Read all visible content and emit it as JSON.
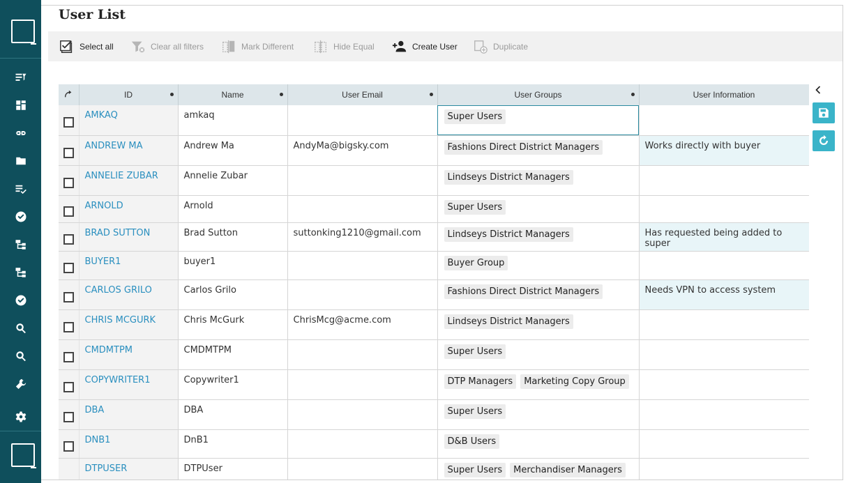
{
  "page": {
    "title": "User List"
  },
  "toolbar": {
    "select_all": "Select all",
    "clear_filters": "Clear all filters",
    "mark_different": "Mark Different",
    "hide_equal": "Hide Equal",
    "create_user": "Create User",
    "duplicate": "Duplicate"
  },
  "columns": {
    "id": "ID",
    "name": "Name",
    "email": "User Email",
    "groups": "User Groups",
    "info": "User Information"
  },
  "rows": [
    {
      "id": "AMKAQ",
      "name": "amkaq",
      "email": "",
      "groups": [
        "Super Users"
      ],
      "info": ""
    },
    {
      "id": "ANDREW MA",
      "name": "Andrew Ma",
      "email": "AndyMa@bigsky.com",
      "groups": [
        "Fashions Direct District Managers"
      ],
      "info": "Works directly with buyer"
    },
    {
      "id": "ANNELIE ZUBAR",
      "name": "Annelie Zubar",
      "email": "",
      "groups": [
        "Lindseys District Managers"
      ],
      "info": ""
    },
    {
      "id": "ARNOLD",
      "name": "Arnold",
      "email": "",
      "groups": [
        "Super Users"
      ],
      "info": ""
    },
    {
      "id": "BRAD SUTTON",
      "name": "Brad Sutton",
      "email": "suttonking1210@gmail.com",
      "groups": [
        "Lindseys District Managers"
      ],
      "info": "Has requested being added to super"
    },
    {
      "id": "BUYER1",
      "name": "buyer1",
      "email": "",
      "groups": [
        "Buyer Group"
      ],
      "info": ""
    },
    {
      "id": "CARLOS GRILO",
      "name": "Carlos Grilo",
      "email": "",
      "groups": [
        "Fashions Direct District Managers"
      ],
      "info": "Needs VPN to access system"
    },
    {
      "id": "CHRIS MCGURK",
      "name": "Chris McGurk",
      "email": "ChrisMcg@acme.com",
      "groups": [
        "Lindseys District Managers"
      ],
      "info": ""
    },
    {
      "id": "CMDMTPM",
      "name": "CMDMTPM",
      "email": "",
      "groups": [
        "Super Users"
      ],
      "info": ""
    },
    {
      "id": "COPYWRITER1",
      "name": "Copywriter1",
      "email": "",
      "groups": [
        "DTP Managers",
        "Marketing Copy Group"
      ],
      "info": ""
    },
    {
      "id": "DBA",
      "name": "DBA",
      "email": "",
      "groups": [
        "Super Users"
      ],
      "info": ""
    },
    {
      "id": "DNB1",
      "name": "DnB1",
      "email": "",
      "groups": [
        "D&B Users"
      ],
      "info": ""
    },
    {
      "id": "DTPUSER",
      "name": "DTPUser",
      "email": "",
      "groups": [
        "Super Users",
        "Merchandiser Managers"
      ],
      "info": ""
    }
  ],
  "colors": {
    "sidebar": "#0f4f5c",
    "link": "#2a8fbf",
    "accent_button": "#3ab4c9",
    "highlight_row": "#e8f5f8"
  },
  "sidebar_icons": [
    "list-filter-icon",
    "dashboard-icon",
    "link-icon",
    "folder-icon",
    "checklist-icon",
    "check-circle-icon",
    "hierarchy-icon",
    "hierarchy-icon",
    "check-circle-icon",
    "search-icon",
    "search-icon",
    "wrench-icon",
    "gear-icon"
  ]
}
